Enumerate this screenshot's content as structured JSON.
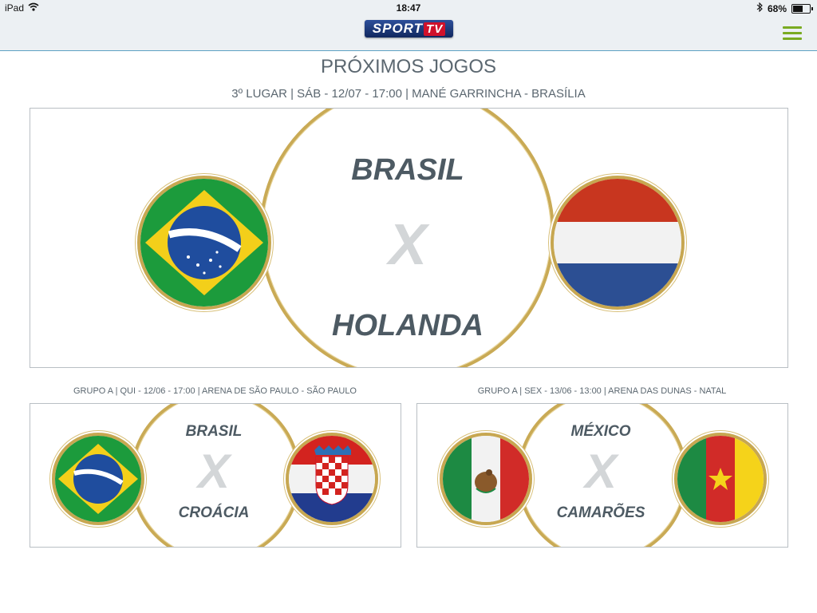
{
  "status_bar": {
    "device": "iPad",
    "time": "18:47",
    "battery": "68%",
    "battery_level": 0.68
  },
  "header": {
    "logo": "SPORTV",
    "logo_sport": "SPORT",
    "logo_tv": "TV"
  },
  "page": {
    "title": "PRÓXIMOS JOGOS"
  },
  "featured": {
    "info": "3º LUGAR | SÁB - 12/07 - 17:00 | MANÉ GARRINCHA - BRASÍLIA",
    "home": "BRASIL",
    "away": "HOLANDA",
    "vs": "X"
  },
  "games": [
    {
      "info": "GRUPO A | QUI - 12/06 - 17:00 | ARENA DE SÃO PAULO - SÃO PAULO",
      "home": "BRASIL",
      "away": "CROÁCIA",
      "vs": "X"
    },
    {
      "info": "GRUPO A | SEX - 13/06 - 13:00 | ARENA DAS DUNAS - NATAL",
      "home": "MÉXICO",
      "away": "CAMARÕES",
      "vs": "X"
    }
  ],
  "flag_banner": "ORDEM E PROGRESSO",
  "colors": {
    "accent_menu": "#7aab21",
    "gold": "#c9aa55",
    "brazil_green": "#1c9b3c",
    "brazil_yellow": "#f3cf1a",
    "brazil_blue": "#1f4d9e"
  }
}
